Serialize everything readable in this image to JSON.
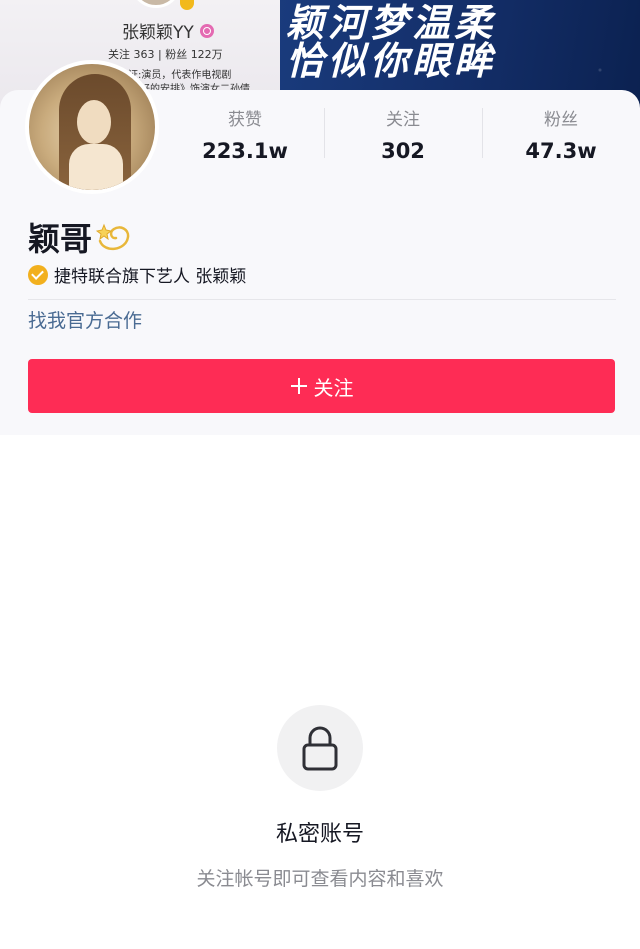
{
  "banner": {
    "cover_name": "张颖颖YY",
    "cover_stats": "关注 363 | 粉丝 122万",
    "cover_desc_1": "证:演员，代表作电视剧",
    "cover_desc_2": "好的安排》饰演女二孙倩",
    "slogan_line_1": "颖河梦温柔",
    "slogan_line_2": "恰似你眼眸"
  },
  "profile": {
    "nickname": "颖哥",
    "verification": "捷特联合旗下艺人  张颖颖",
    "coop_link": "找我官方合作",
    "stats": [
      {
        "label": "获赞",
        "value": "223.1w"
      },
      {
        "label": "关注",
        "value": "302"
      },
      {
        "label": "粉丝",
        "value": "47.3w"
      }
    ],
    "follow_button": "关注"
  },
  "private": {
    "title": "私密账号",
    "subtitle": "关注帐号即可查看内容和喜欢"
  },
  "colors": {
    "accent": "#fe2c55",
    "link": "#4a6b93",
    "verify_badge": "#f2b01e"
  },
  "icons": {
    "lock": "lock-icon",
    "plus": "plus-icon",
    "verify": "verified-check-icon",
    "emoji": "dizzy-star-icon"
  }
}
